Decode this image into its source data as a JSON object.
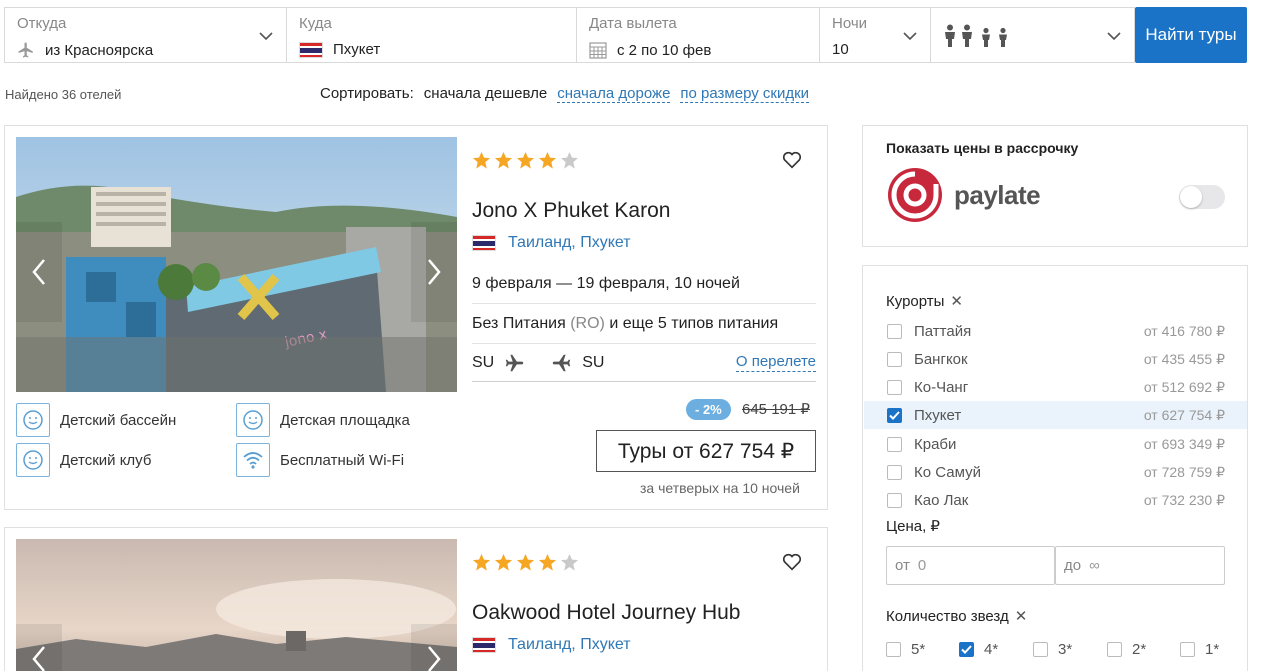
{
  "search": {
    "from_label": "Откуда",
    "from_value": "из Красноярска",
    "to_label": "Куда",
    "to_value": "Пхукет",
    "date_label": "Дата вылета",
    "date_value": "с 2 по 10 фев",
    "nights_label": "Ночи",
    "nights_value": "10",
    "travelers_icon": "family-icon",
    "find_button": "Найти туры"
  },
  "results": {
    "found_text": "Найдено 36 отелей",
    "sort_label": "Сортировать:",
    "sort_active": "сначала дешевле",
    "sort_options": [
      "сначала дороже",
      "по размеру скидки"
    ]
  },
  "hotels": [
    {
      "stars": 4,
      "max_stars": 5,
      "name": "Jono X Phuket Karon",
      "location": "Таиланд, Пхукет",
      "dates": "9 февраля — 19 февраля, 10 ночей",
      "meal_prefix": "Без Питания",
      "meal_code": "(RO)",
      "meal_suffix": "и еще 5 типов питания",
      "flight_from": "SU",
      "flight_to": "SU",
      "flight_link": "О перелете",
      "discount": "- 2%",
      "old_price": "645 191 ₽",
      "price_button": "Туры от 627 754 ₽",
      "price_note": "за четверых на 10 ночей",
      "amenities": [
        "Детский бассейн",
        "Детская площадка",
        "Детский клуб",
        "Бесплатный Wi-Fi"
      ]
    },
    {
      "stars": 4,
      "max_stars": 5,
      "name": "Oakwood Hotel Journey Hub",
      "location": "Таиланд, Пхукет"
    }
  ],
  "paylate": {
    "title": "Показать цены в рассрочку",
    "brand": "paylate",
    "enabled": false
  },
  "filters": {
    "resorts_title": "Курорты",
    "resorts": [
      {
        "name": "Паттайя",
        "price": "от 416 780 ₽",
        "checked": false
      },
      {
        "name": "Бангкок",
        "price": "от 435 455 ₽",
        "checked": false
      },
      {
        "name": "Ко-Чанг",
        "price": "от 512 692 ₽",
        "checked": false
      },
      {
        "name": "Пхукет",
        "price": "от 627 754 ₽",
        "checked": true
      },
      {
        "name": "Краби",
        "price": "от 693 349 ₽",
        "checked": false
      },
      {
        "name": "Ко Самуй",
        "price": "от 728 759 ₽",
        "checked": false
      },
      {
        "name": "Као Лак",
        "price": "от 732 230 ₽",
        "checked": false
      }
    ],
    "price_title": "Цена, ₽",
    "price_from_label": "от",
    "price_from_value": "0",
    "price_to_label": "до",
    "price_to_value": "∞",
    "stars_title": "Количество звезд",
    "star_options": [
      {
        "label": "5*",
        "checked": false
      },
      {
        "label": "4*",
        "checked": true
      },
      {
        "label": "3*",
        "checked": false
      },
      {
        "label": "2*",
        "checked": false
      },
      {
        "label": "1*",
        "checked": false
      }
    ]
  },
  "colors": {
    "accent": "#1a73c6",
    "link": "#2f78b5",
    "star": "#f5a623",
    "discount": "#6caee0",
    "paylate": "#c8283c"
  }
}
